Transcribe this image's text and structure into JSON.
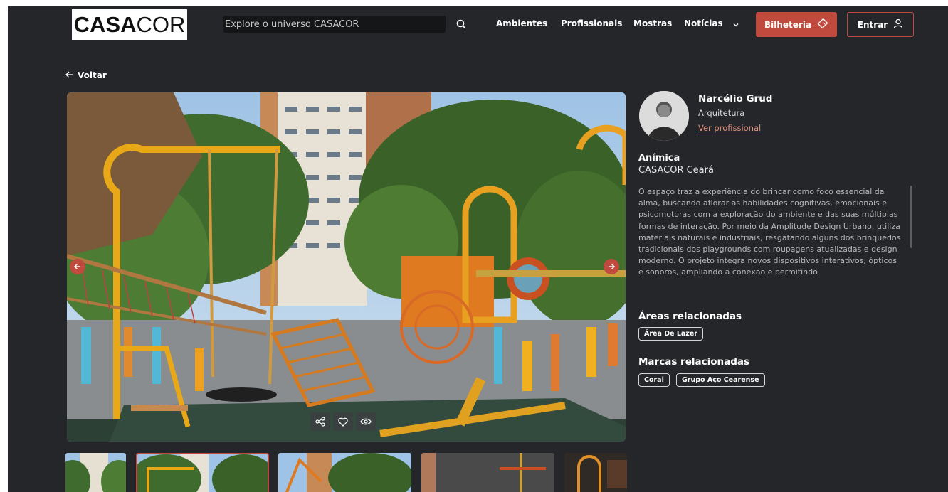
{
  "header": {
    "logo": {
      "bold": "CASA",
      "light": "COR"
    },
    "search_placeholder": "Explore o universo CASACOR",
    "nav": [
      "Ambientes",
      "Profissionais",
      "Mostras",
      "Notícias"
    ],
    "bilheteria_label": "Bilheteria",
    "entrar_label": "Entrar"
  },
  "back_label": "Voltar",
  "professional": {
    "name": "Narcélio Grud",
    "role": "Arquitetura",
    "link": "Ver profissional"
  },
  "ambiente": {
    "title": "Anímica",
    "mostra": "CASACOR Ceará",
    "description": "O espaço traz a experiência do brincar como foco essencial da alma, buscando aflorar as habilidades cognitivas, emocionais e psicomotoras com a exploração do ambiente e das suas múltiplas formas de interação. Por meio da Amplitude Design Urbano, utiliza materiais naturais e industriais, resgatando alguns dos brinquedos tradicionais dos playgrounds com roupagens atualizadas e design moderno. O projeto integra novos dispositivos interativos, ópticos e sonoros, ampliando a conexão e permitindo"
  },
  "related_areas": {
    "title": "Áreas relacionadas",
    "tags": [
      "Área De Lazer"
    ]
  },
  "related_brands": {
    "title": "Marcas relacionadas",
    "tags": [
      "Coral",
      "Grupo Aço Cearense"
    ]
  },
  "colors": {
    "background": "#242629",
    "accent": "#c04a3e",
    "link": "#e0907f"
  }
}
